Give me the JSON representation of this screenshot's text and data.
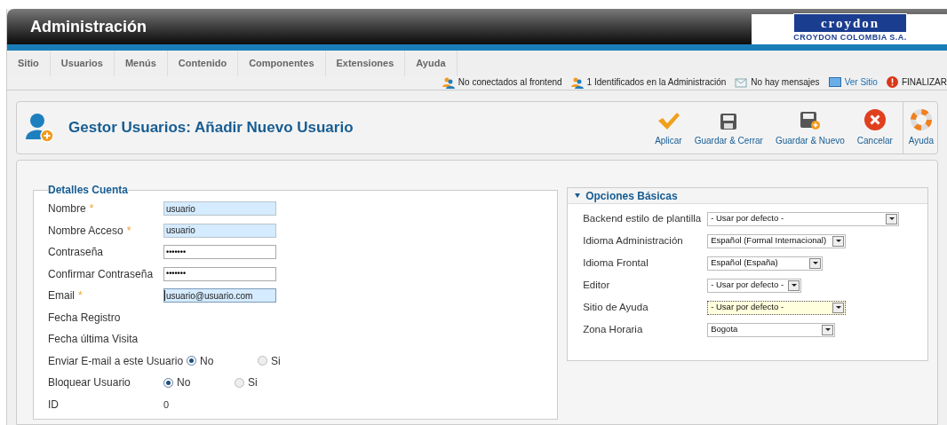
{
  "header": {
    "title": "Administración",
    "logo": {
      "brand": "croydon",
      "company": "CROYDON COLOMBIA S.A."
    }
  },
  "menu": [
    {
      "label": "Sitio"
    },
    {
      "label": "Usuarios"
    },
    {
      "label": "Menús"
    },
    {
      "label": "Contenido"
    },
    {
      "label": "Componentes"
    },
    {
      "label": "Extensiones"
    },
    {
      "label": "Ayuda"
    }
  ],
  "status": [
    {
      "kind": "users",
      "label": "No conectados al frontend"
    },
    {
      "kind": "users",
      "label": "1 Identificados en la Administración"
    },
    {
      "kind": "mail",
      "label": "No hay mensajes"
    },
    {
      "kind": "link",
      "label": "Ver Sitio"
    },
    {
      "kind": "logout",
      "label": "FINALIZAR"
    }
  ],
  "toolbar": {
    "title": "Gestor Usuarios: Añadir Nuevo Usuario",
    "buttons": [
      {
        "kind": "apply",
        "label": "Aplicar"
      },
      {
        "kind": "save",
        "label": "Guardar & Cerrar"
      },
      {
        "kind": "save-new",
        "label": "Guardar & Nuevo"
      },
      {
        "kind": "cancel",
        "label": "Cancelar"
      },
      {
        "kind": "help",
        "label": "Ayuda"
      }
    ]
  },
  "account": {
    "legend": "Detalles Cuenta",
    "fields": [
      {
        "kind": "text",
        "label": "Nombre",
        "required_mark": "*",
        "value": "usuario",
        "focused": false
      },
      {
        "kind": "text",
        "label": "Nombre Acceso",
        "required_mark": "*",
        "value": "usuario",
        "focused": false
      },
      {
        "kind": "password",
        "label": "Contraseña",
        "value": "•••••••",
        "focused": false
      },
      {
        "kind": "password",
        "label": "Confirmar Contraseña",
        "value": "•••••••",
        "focused": false
      },
      {
        "kind": "text",
        "label": "Email",
        "required_mark": "*",
        "value": "usuario@usuario.com",
        "focused": true
      },
      {
        "kind": "static",
        "label": "Fecha Registro"
      },
      {
        "kind": "static",
        "label": "Fecha última Visita"
      },
      {
        "kind": "radio",
        "label": "Enviar E-mail a este Usuario",
        "options": [
          {
            "label": "No",
            "selected": true
          },
          {
            "label": "Si",
            "selected": false
          }
        ]
      },
      {
        "kind": "radio",
        "label": "Bloquear Usuario",
        "options": [
          {
            "label": "No",
            "selected": true
          },
          {
            "label": "Si",
            "selected": false
          }
        ]
      },
      {
        "kind": "static",
        "label": "ID",
        "value": "0"
      }
    ]
  },
  "options": {
    "title": "Opciones Básicas",
    "expanded": true,
    "fields": [
      {
        "label": "Backend estilo de plantilla",
        "value": "- Usar por defecto -",
        "focused": false
      },
      {
        "label": "Idioma Administración",
        "value": "Español (Formal Internacional)",
        "focused": false
      },
      {
        "label": "Idioma Frontal",
        "value": "Español (España)",
        "focused": false
      },
      {
        "label": "Editor",
        "value": "- Usar por defecto -",
        "focused": false
      },
      {
        "label": "Sitio de Ayuda",
        "value": "- Usar por defecto -",
        "focused": true
      },
      {
        "label": "Zona Horaria",
        "value": "Bogota",
        "focused": false
      }
    ]
  }
}
